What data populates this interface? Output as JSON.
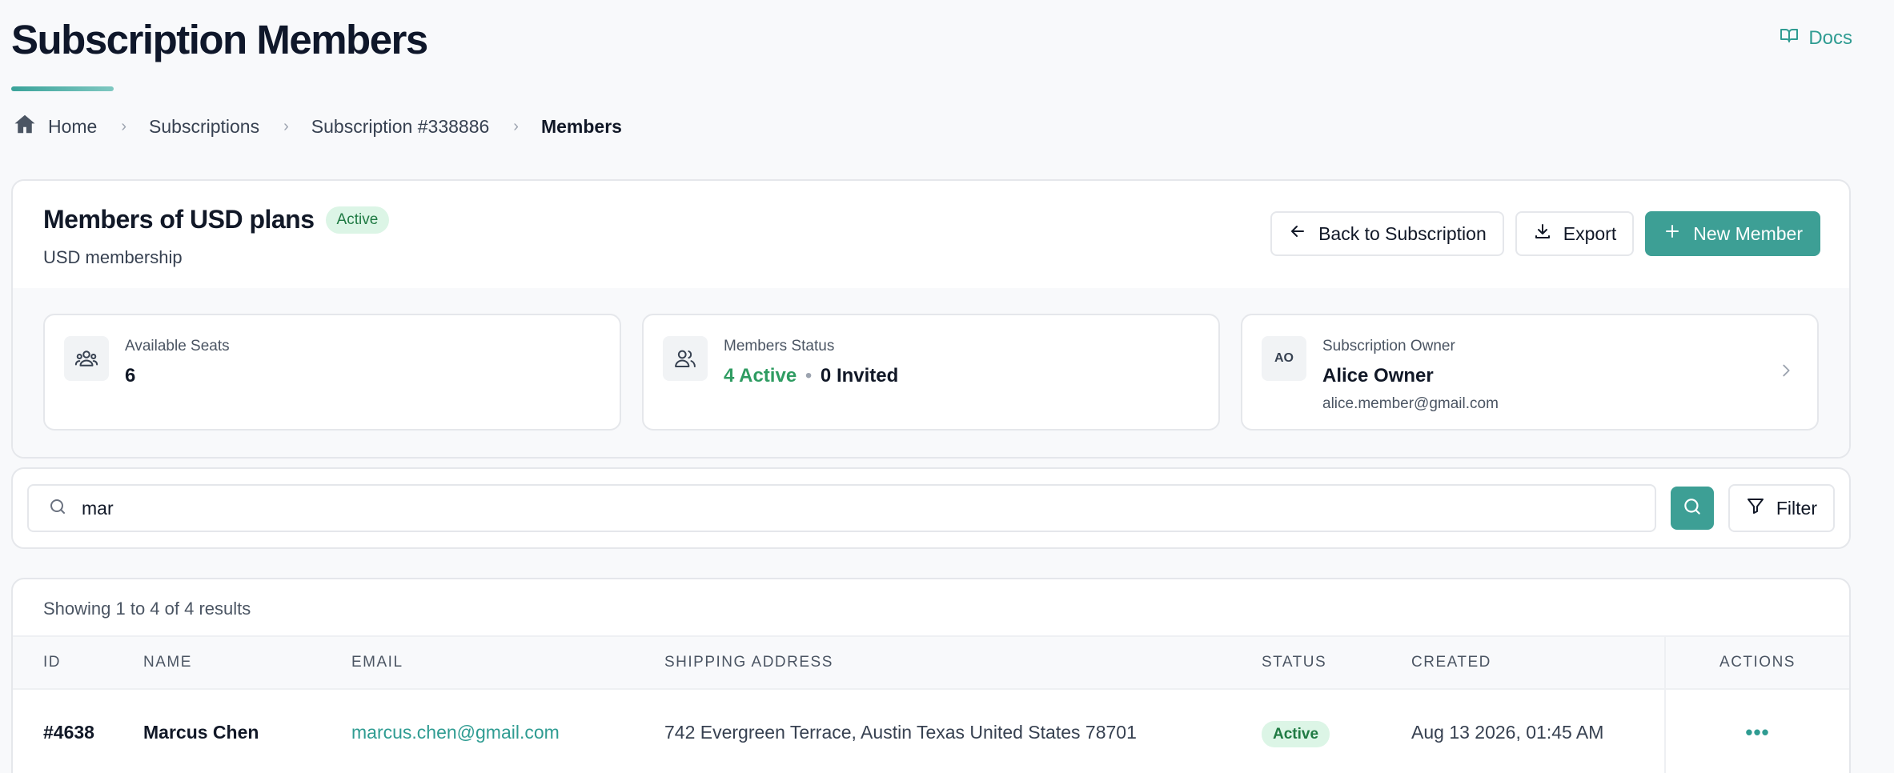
{
  "page": {
    "title": "Subscription Members",
    "docs_label": "Docs"
  },
  "breadcrumb": [
    {
      "label": "Home"
    },
    {
      "label": "Subscriptions"
    },
    {
      "label": "Subscription #338886"
    },
    {
      "label": "Members"
    }
  ],
  "summary": {
    "title": "Members of USD plans",
    "status_badge": "Active",
    "subtitle": "USD membership",
    "actions": {
      "back_label": "Back to Subscription",
      "export_label": "Export",
      "new_member_label": "New Member"
    },
    "stats": {
      "seats": {
        "label": "Available Seats",
        "value": "6"
      },
      "members": {
        "label": "Members Status",
        "active": "4 Active",
        "separator": "•",
        "invited": "0 Invited"
      },
      "owner": {
        "label": "Subscription Owner",
        "initials": "AO",
        "name": "Alice Owner",
        "email": "alice.member@gmail.com"
      }
    }
  },
  "search": {
    "value": "mar",
    "filter_label": "Filter"
  },
  "table": {
    "results_text": "Showing 1 to 4 of 4 results",
    "columns": [
      "ID",
      "NAME",
      "EMAIL",
      "SHIPPING ADDRESS",
      "STATUS",
      "CREATED",
      "ACTIONS"
    ],
    "rows": [
      {
        "id": "#4638",
        "name": "Marcus Chen",
        "email": "marcus.chen@gmail.com",
        "address": "742 Evergreen Terrace, Austin Texas United States 78701",
        "status": "Active",
        "created": "Aug 13 2026, 01:45 AM",
        "actions": "•••"
      }
    ]
  },
  "colors": {
    "accent": "#3d9f95",
    "link": "#2f9c92",
    "active_bg": "#dcf5e6",
    "active_text": "#1f7a43"
  }
}
